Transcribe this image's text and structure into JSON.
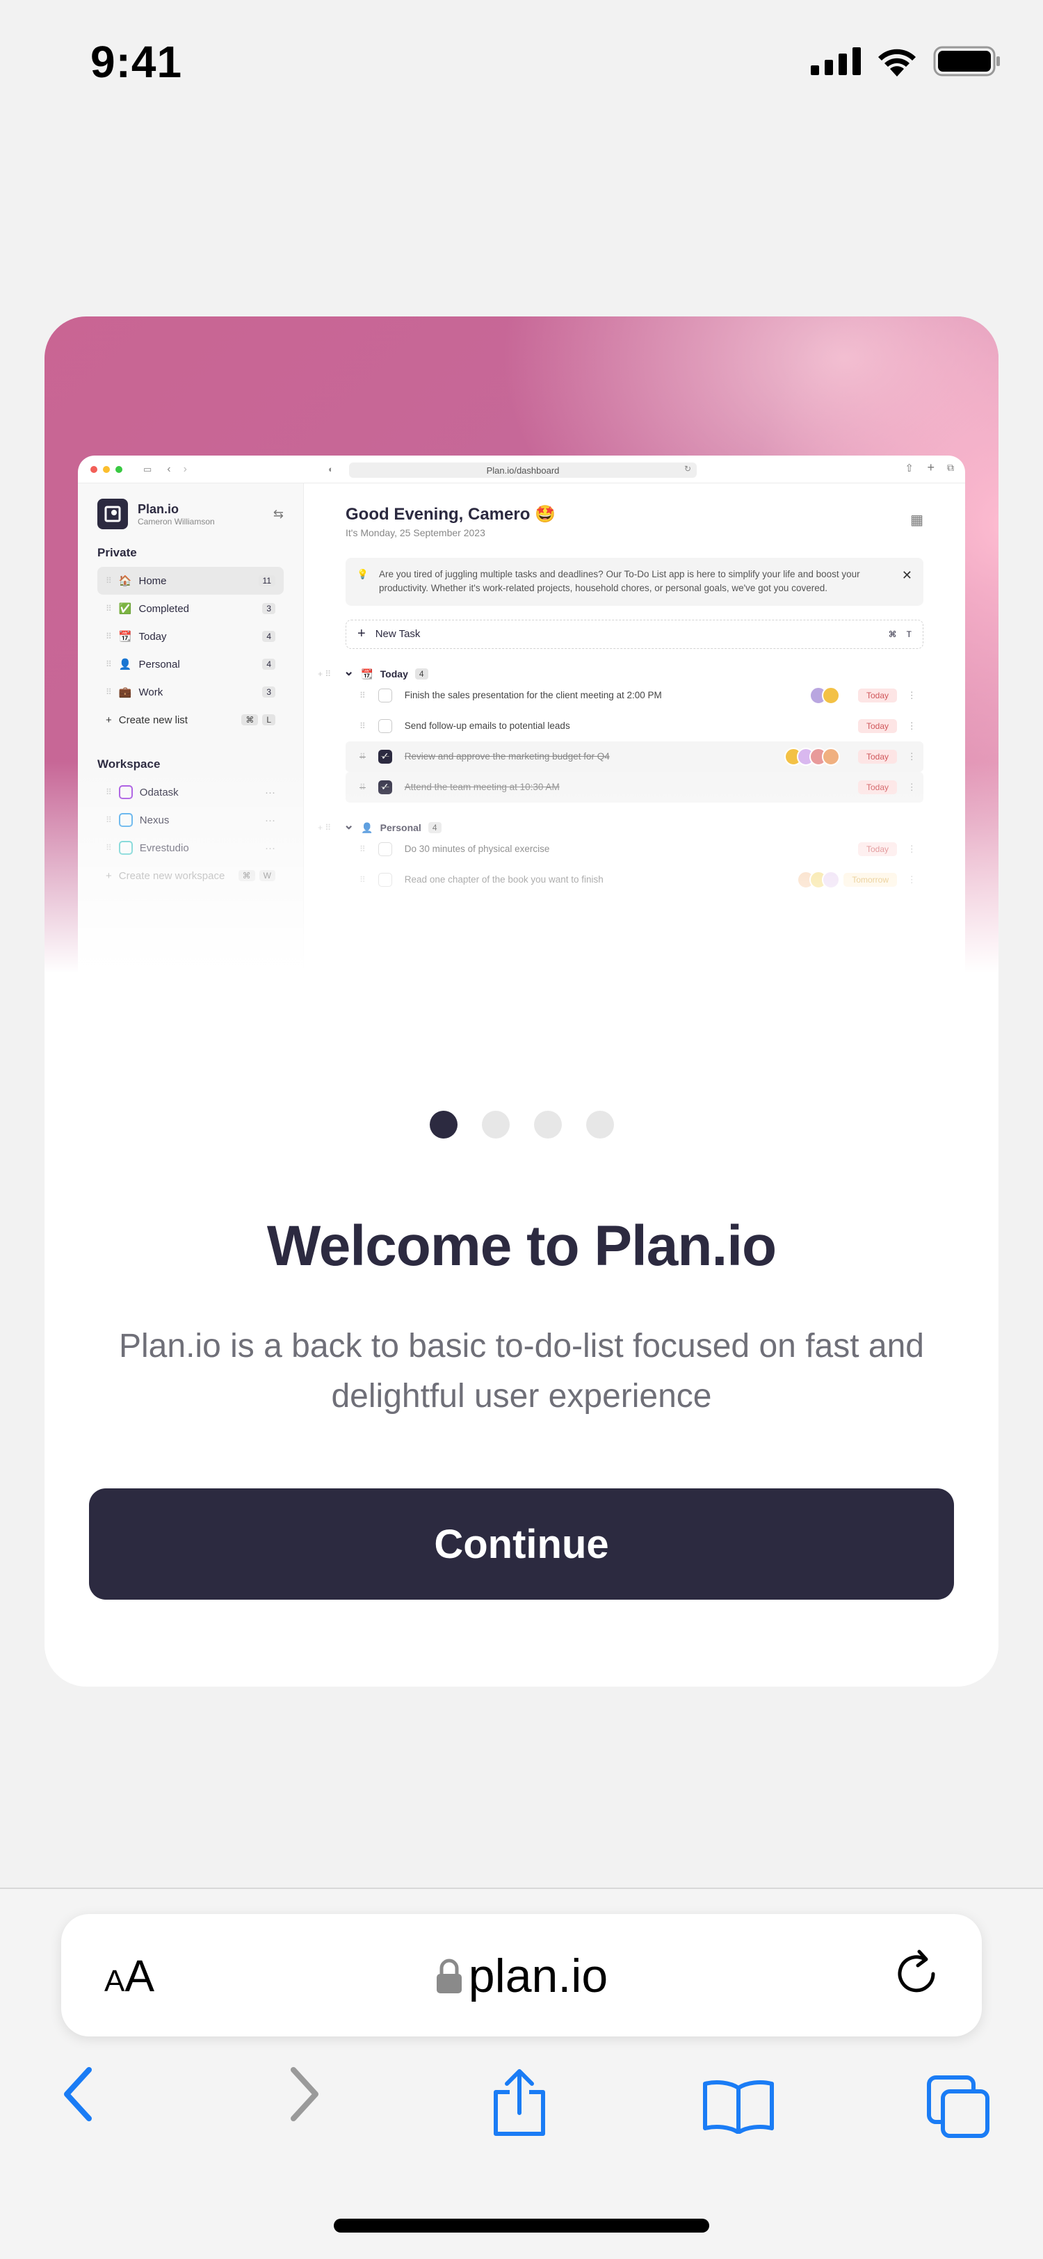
{
  "status": {
    "time": "9:41",
    "icons": [
      "signal-icon",
      "wifi-icon",
      "battery-icon"
    ]
  },
  "mock": {
    "url": "Plan.io/dashboard",
    "app_name": "Plan.io",
    "user": "Cameron Williamson",
    "private_label": "Private",
    "lists": [
      {
        "label": "Home",
        "count": "11",
        "emoji": "🏠",
        "active": true
      },
      {
        "label": "Completed",
        "count": "3",
        "emoji": "✅"
      },
      {
        "label": "Today",
        "count": "4",
        "emoji": "📆"
      },
      {
        "label": "Personal",
        "count": "4",
        "emoji": "👤"
      },
      {
        "label": "Work",
        "count": "3",
        "emoji": "💼"
      }
    ],
    "create_list": "Create new list",
    "create_list_keys": [
      "⌘",
      "L"
    ],
    "workspace_label": "Workspace",
    "workspaces": [
      {
        "label": "Odatask",
        "color": "#a34ee0"
      },
      {
        "label": "Nexus",
        "color": "#3aa0e8"
      },
      {
        "label": "Evrestudio",
        "color": "#3fc4c4"
      }
    ],
    "create_workspace": "Create new workspace",
    "create_workspace_keys": [
      "⌘",
      "W"
    ],
    "greeting": "Good Evening, Camero 🤩",
    "date": "It's Monday, 25 September 2023",
    "banner": "Are you tired of juggling multiple tasks and deadlines? Our To-Do List app is here to simplify your life and boost your productivity. Whether it's work-related projects, household chores, or personal goals, we've got you covered.",
    "new_task": "New Task",
    "new_task_keys": [
      "⌘",
      "T"
    ],
    "groups": [
      {
        "label": "Today",
        "emoji": "📆",
        "count": "4",
        "tasks": [
          {
            "text": "Finish the sales presentation for the client meeting at 2:00 PM",
            "due": "Today",
            "done": false,
            "avatars": [
              "#b9a6e0",
              "#f3c145"
            ]
          },
          {
            "text": "Send follow-up emails to potential leads",
            "due": "Today",
            "done": false,
            "avatars": []
          },
          {
            "text": "Review and approve the marketing budget for Q4",
            "due": "Today",
            "done": true,
            "avatars": [
              "#f3c145",
              "#d9b8ef",
              "#e89a9a",
              "#f0b080"
            ]
          },
          {
            "text": "Attend the team meeting at 10:30 AM",
            "due": "Today",
            "done": true,
            "avatars": []
          }
        ]
      },
      {
        "label": "Personal",
        "emoji": "👤",
        "count": "4",
        "tasks": [
          {
            "text": "Do 30 minutes of physical exercise",
            "due": "Today",
            "done": false,
            "avatars": []
          },
          {
            "text": "Read one chapter of the book you want to finish",
            "due": "Tomorrow",
            "done": false,
            "avatars": [
              "#f7c9a0",
              "#f3d66a",
              "#e6d0f0"
            ]
          }
        ]
      }
    ]
  },
  "pager": {
    "count": 4,
    "active": 0
  },
  "welcome": {
    "title": "Welcome to Plan.io",
    "subtitle": "Plan.io is a back to basic to-do-list focused on fast and delightful user experience",
    "cta": "Continue"
  },
  "safari": {
    "aa_small": "A",
    "aa_large": "A",
    "domain": "plan.io",
    "accent": "#1a7cf5"
  }
}
